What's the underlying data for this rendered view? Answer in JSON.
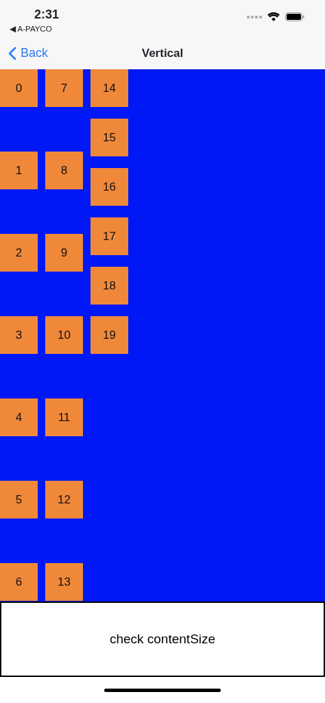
{
  "status_bar": {
    "time": "2:31",
    "back_app": "◀ A-PAYCO"
  },
  "nav": {
    "back": "Back",
    "title": "Vertical"
  },
  "columns": [
    {
      "cells": [
        "0",
        "1",
        "2",
        "3",
        "4",
        "5",
        "6"
      ]
    },
    {
      "cells": [
        "7",
        "8",
        "9",
        "10",
        "11",
        "12",
        "13"
      ]
    },
    {
      "cells": [
        "14",
        "15",
        "16",
        "17",
        "18",
        "19"
      ]
    }
  ],
  "button": "check contentSize"
}
